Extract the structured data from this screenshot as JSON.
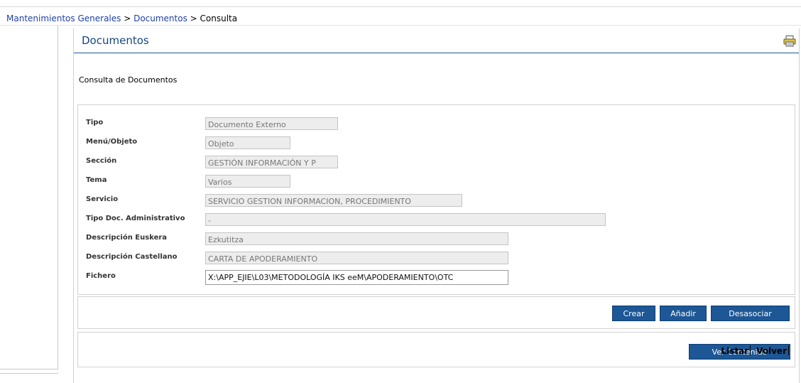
{
  "breadcrumb": {
    "item1": "Mantenimientos Generales",
    "sep1": " > ",
    "item2": "Documentos",
    "sep2": " > ",
    "current": "Consulta"
  },
  "header": {
    "title": "Documentos",
    "print_icon": "printer-icon"
  },
  "subtitle": "Consulta de Documentos",
  "form": {
    "fields": [
      {
        "label": "Tipo",
        "value": "Documento Externo"
      },
      {
        "label": "Menú/Objeto",
        "value": "Objeto"
      },
      {
        "label": "Sección",
        "value": "GESTIÓN INFORMACIÓN Y P"
      },
      {
        "label": "Tema",
        "value": "Varios"
      },
      {
        "label": "Servicio",
        "value": "SERVICIO GESTION INFORMACION, PROCEDIMIENTO"
      },
      {
        "label": "Tipo Doc. Administrativo",
        "value": "-"
      },
      {
        "label": "Descripción Euskera",
        "value": "Ezkutitza"
      },
      {
        "label": "Descripción Castellano",
        "value": "CARTA DE APODERAMIENTO"
      },
      {
        "label": "Fichero",
        "value": "X:\\APP_EJIE\\L03\\METODOLOGÍA IKS eeM\\APODERAMIENTO\\OTC"
      }
    ]
  },
  "actions": {
    "crear": "Crear",
    "anadir": "Añadir",
    "desasociar": "Desasociar",
    "ver_contenido": "Ver Contenido"
  },
  "footer": {
    "listar": "Listar",
    "volver": "Volver"
  },
  "colors": {
    "accent": "#1d5795",
    "title": "#14467f",
    "link": "#1f3fa8"
  }
}
